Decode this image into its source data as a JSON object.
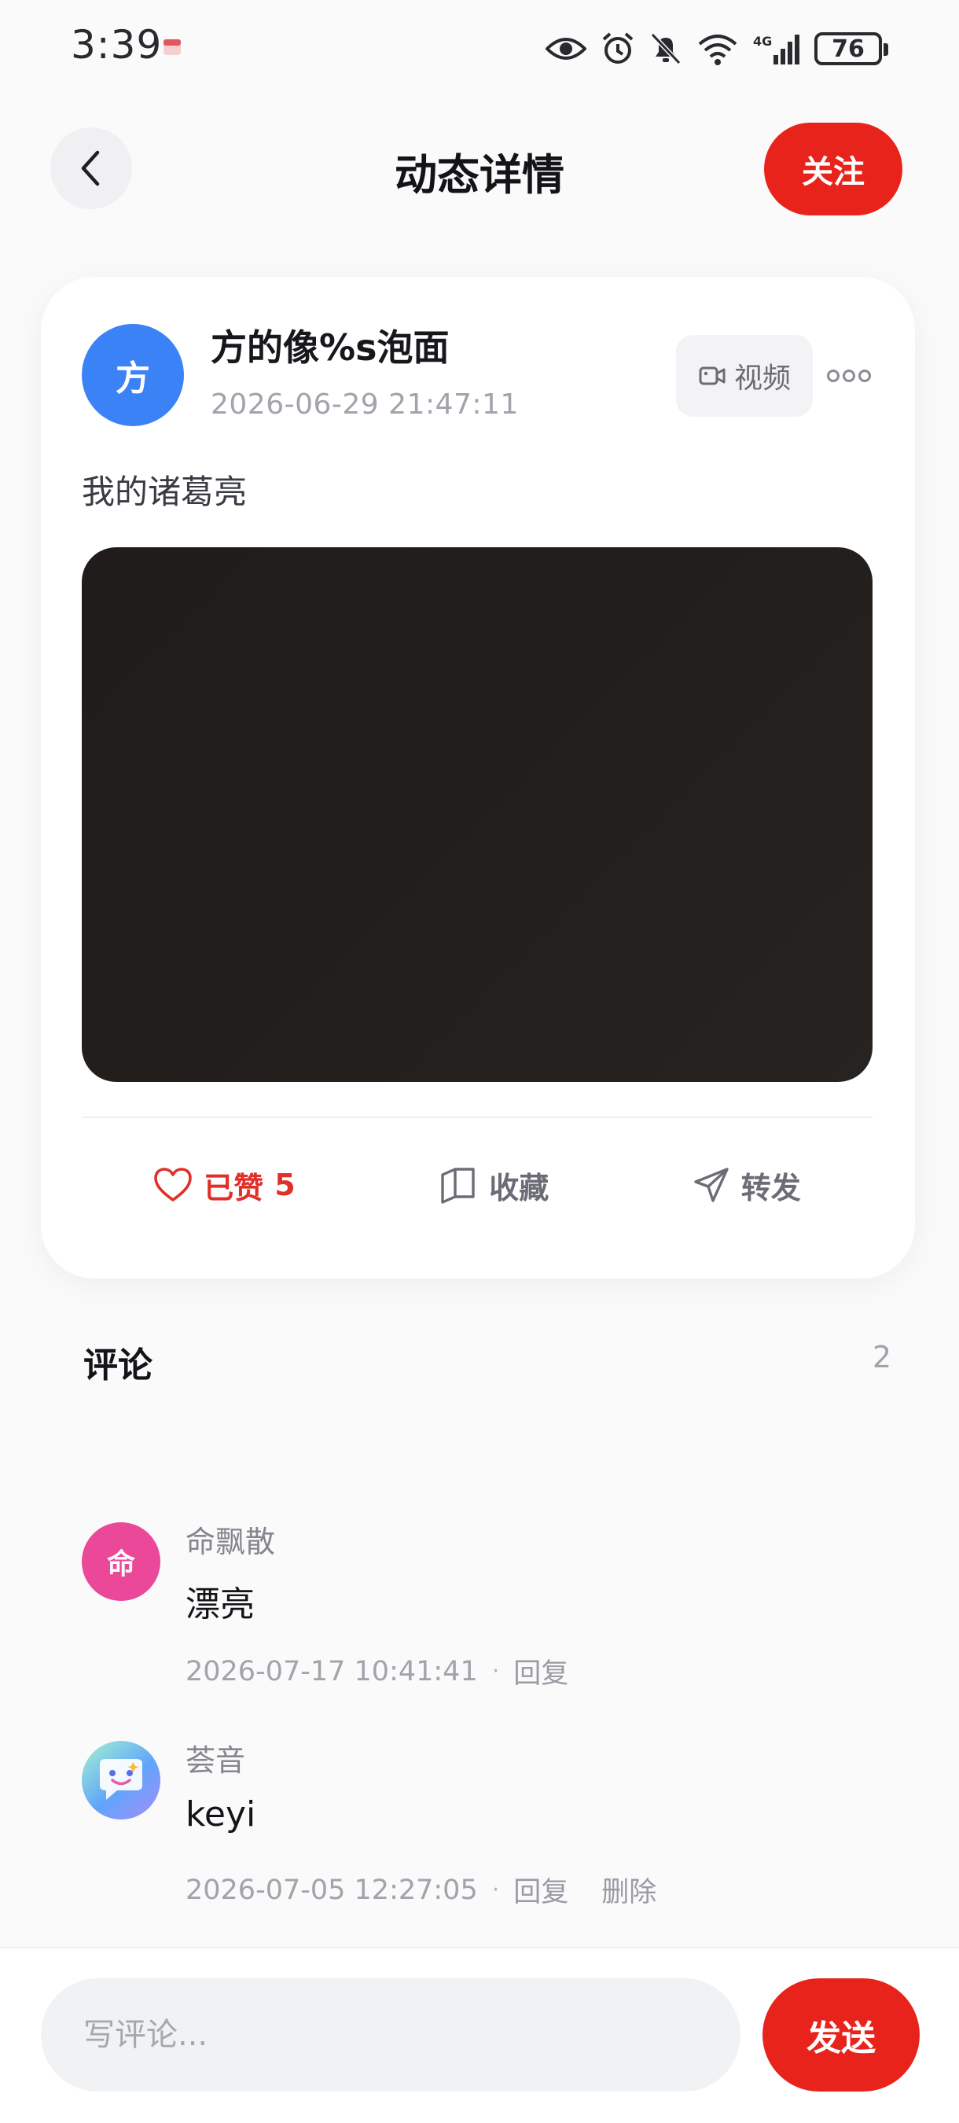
{
  "status_bar": {
    "time": "3:39",
    "network": "4G",
    "battery": "76"
  },
  "header": {
    "title": "动态详情",
    "follow_label": "关注"
  },
  "post": {
    "author_initial": "方",
    "author_name": "方的像%s泡面",
    "time": "2026-06-29 21:47:11",
    "media_tag": "视频",
    "text": "我的诸葛亮",
    "actions": {
      "like_label": "已赞",
      "like_count": "5",
      "favorite_label": "收藏",
      "share_label": "转发"
    }
  },
  "comments": {
    "title": "评论",
    "count": "2",
    "items": [
      {
        "avatar_initial": "命",
        "avatar_color": "#ec4899",
        "user": "命飘散",
        "text": "漂亮",
        "time": "2026-07-17 10:41:41",
        "reply_label": "回复"
      },
      {
        "avatar_icon": "chat-bubble-face-icon",
        "user": "荟音",
        "text": "keyi",
        "time": "2026-07-05 12:27:05",
        "reply_label": "回复",
        "delete_label": "删除"
      }
    ]
  },
  "composer": {
    "placeholder": "写评论...",
    "send_label": "发送"
  },
  "colors": {
    "accent_red": "#e8231b",
    "author_avatar_blue": "#3b82f6",
    "muted_text": "#a2a3ab"
  }
}
